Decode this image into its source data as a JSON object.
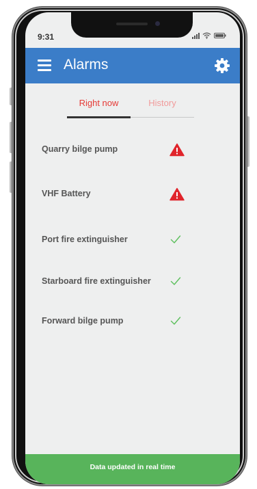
{
  "status_bar": {
    "time": "9:31"
  },
  "header": {
    "title": "Alarms",
    "color": "#3b7dc8"
  },
  "tabs": [
    {
      "label": "Right now",
      "active": true
    },
    {
      "label": "History",
      "active": false
    }
  ],
  "alarms": [
    {
      "label": "Quarry bilge pump",
      "status": "warning",
      "icon": "warning-triangle-icon"
    },
    {
      "label": "VHF Battery",
      "status": "warning",
      "icon": "warning-triangle-icon"
    },
    {
      "label": "Port fire extinguisher",
      "status": "ok",
      "icon": "check-icon"
    },
    {
      "label": "Starboard fire extinguisher",
      "status": "ok",
      "icon": "check-icon"
    },
    {
      "label": "Forward bilge pump",
      "status": "ok",
      "icon": "check-icon"
    }
  ],
  "footer": {
    "text": "Data updated in real time",
    "color": "#58b45b"
  },
  "colors": {
    "warning": "#e0242b",
    "ok": "#5cbf5c",
    "tab_active": "#e53935",
    "tab_inactive": "#f19a9a"
  }
}
